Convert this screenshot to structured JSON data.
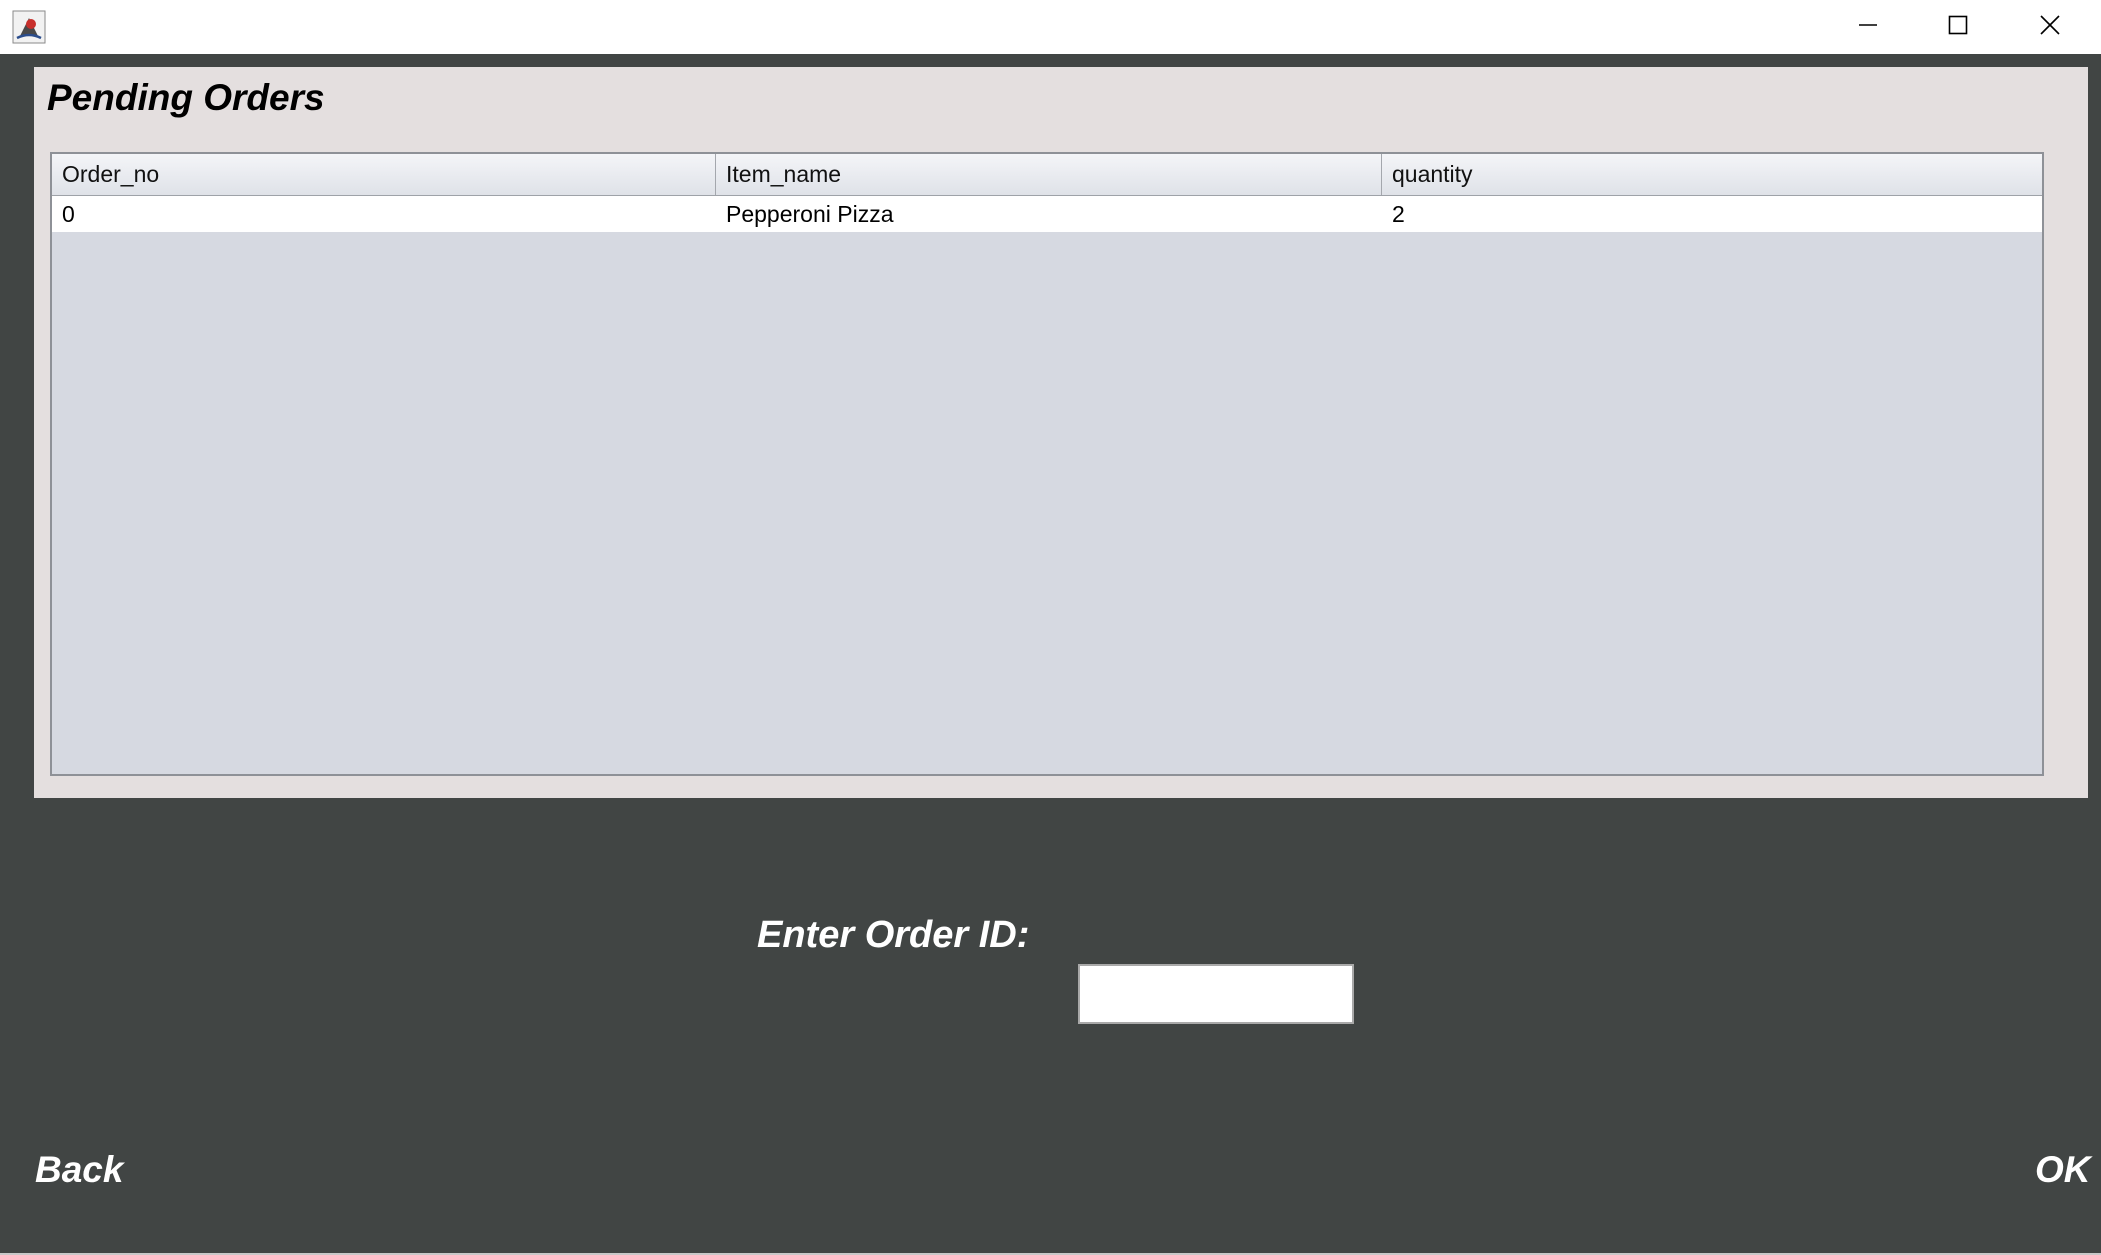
{
  "window": {
    "title": "",
    "controls": {
      "minimize_icon": "minimize-icon",
      "maximize_icon": "maximize-icon",
      "close_icon": "close-icon"
    }
  },
  "panel": {
    "title": "Pending Orders"
  },
  "table": {
    "columns": [
      "Order_no",
      "Item_name",
      "quantity"
    ],
    "rows": [
      [
        "0",
        "Pepperoni Pizza",
        "2"
      ]
    ]
  },
  "order_entry": {
    "label": "Enter Order ID:",
    "value": "",
    "placeholder": ""
  },
  "buttons": {
    "back": "Back",
    "ok": "OK"
  },
  "colors": {
    "background": "#414544",
    "panel": "#e4dfdf",
    "table_body": "#d6d9e1"
  }
}
